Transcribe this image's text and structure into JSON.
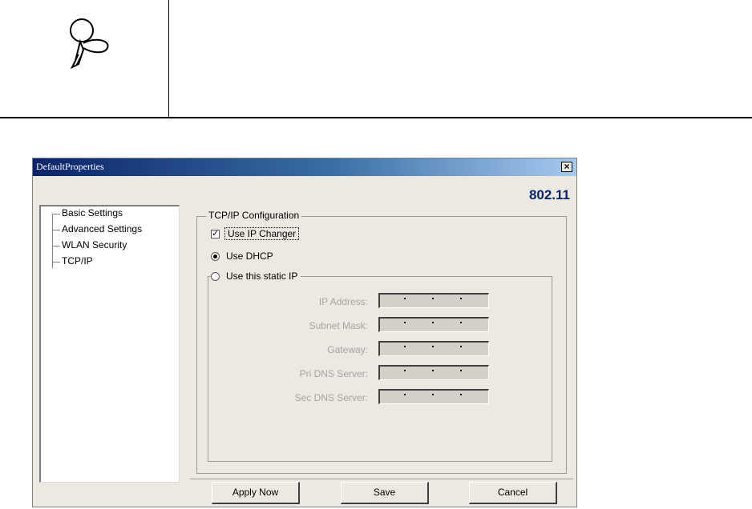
{
  "dialog": {
    "title": "DefaultProperties",
    "brand": "802.11"
  },
  "tree": {
    "items": [
      "Basic Settings",
      "Advanced Settings",
      "WLAN Security",
      "TCP/IP"
    ]
  },
  "tcpip": {
    "group_label": "TCP/IP Configuration",
    "use_ip_changer_label": "Use IP Changer",
    "use_ip_changer_checked": true,
    "use_dhcp_label": "Use DHCP",
    "use_static_label": "Use this static IP",
    "fields": [
      {
        "label": "IP Address:"
      },
      {
        "label": "Subnet Mask:"
      },
      {
        "label": "Gateway:"
      },
      {
        "label": "Pri DNS Server:"
      },
      {
        "label": "Sec DNS Server:"
      }
    ]
  },
  "buttons": {
    "apply": "Apply Now",
    "save": "Save",
    "cancel": "Cancel"
  },
  "icons": {
    "note": "magnifier-icon",
    "close": "close-icon"
  }
}
